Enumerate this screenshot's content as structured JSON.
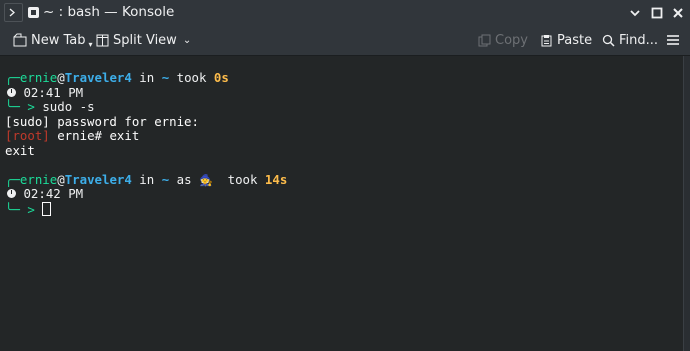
{
  "window": {
    "title": "~ : bash — Konsole"
  },
  "toolbar": {
    "new_tab": "New Tab",
    "split_view": "Split View",
    "copy": "Copy",
    "paste": "Paste",
    "find": "Find..."
  },
  "terminal": {
    "prompt1": {
      "user": "ernie",
      "at": "@",
      "host": "Traveler4",
      "in": " in ",
      "dir": "~",
      "took": " took ",
      "duration": "0s",
      "time": " 02:41 PM",
      "arrow": ">",
      "command": " sudo -s"
    },
    "sudo_prompt": "[sudo] password for ernie:",
    "root_tag": "[root]",
    "root_cmd": " ernie# exit",
    "exit_output": "exit",
    "prompt2": {
      "user": "ernie",
      "at": "@",
      "host": "Traveler4",
      "in": " in ",
      "dir": "~",
      "as": " as ",
      "as_emoji": "🧙",
      "took": "  took ",
      "duration": "14s",
      "time": " 02:42 PM",
      "arrow": ">"
    }
  },
  "colors": {
    "background": "#232627",
    "prompt_green": "#1cdc9a",
    "host_blue": "#3daee9",
    "duration_yellow": "#fdbc4b",
    "root_red": "#c0392b"
  }
}
